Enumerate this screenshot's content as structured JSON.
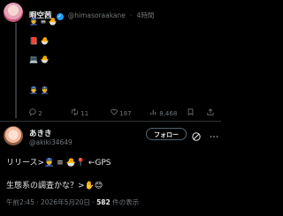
{
  "post1": {
    "author_name": "暇空茜",
    "handle": "@himasoraakane",
    "separator": "·",
    "time": "4時間",
    "lines": [
      "👮 ≡ 🐣",
      "📕 🐣",
      "💻 🐣",
      "👮 👮"
    ],
    "actions": {
      "replies": "2",
      "reposts": "11",
      "likes": "187",
      "views": "8,468"
    }
  },
  "post2": {
    "author_name": "あきき",
    "handle": "@akiki34649",
    "follow_label": "フォロー",
    "line1": "リリース>👮 ≡ 🐣📍 ←GPS",
    "line2": "生態系の調査かな？>✋😊",
    "time_date": "午前2:45 · 2026年5月20日 · ",
    "views_count": "582",
    "views_suffix": " 件の表示"
  },
  "icons": {
    "reply": "reply-icon",
    "repost": "repost-icon",
    "like": "heart-icon",
    "views": "views-icon",
    "bookmark": "bookmark-icon",
    "share": "share-icon",
    "grok": "grok-icon",
    "more": "more-icon"
  },
  "colors": {
    "background": "#000000",
    "text": "#e7e9ea",
    "muted": "#71767b",
    "verified": "#1d9bf0"
  }
}
